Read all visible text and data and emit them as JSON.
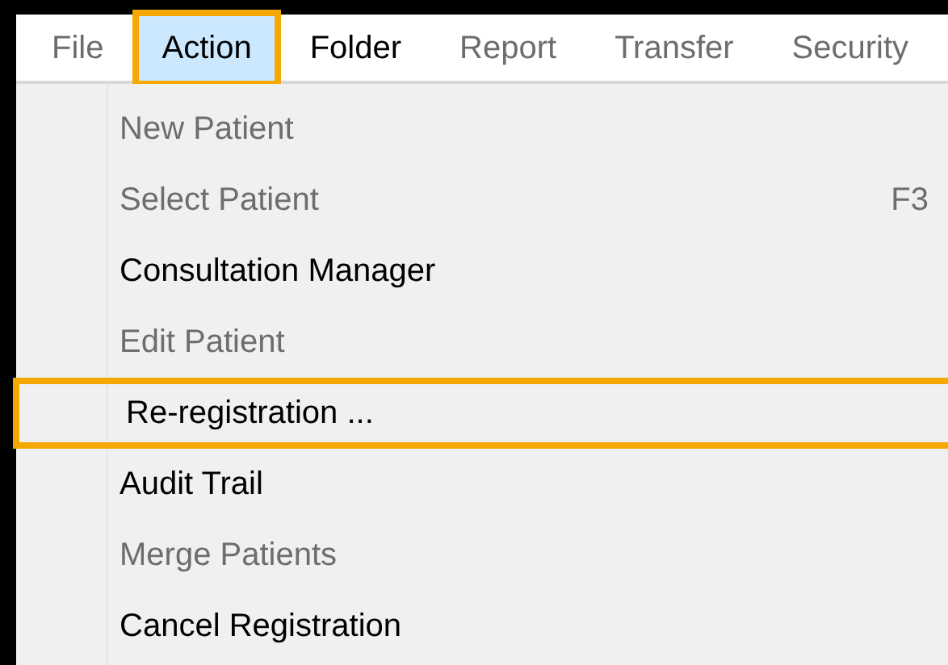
{
  "menu_bar": [
    {
      "label": "File",
      "disabled": true,
      "selected": false,
      "highlighted": false
    },
    {
      "label": "Action",
      "disabled": false,
      "selected": true,
      "highlighted": true
    },
    {
      "label": "Folder",
      "disabled": false,
      "selected": false,
      "highlighted": false
    },
    {
      "label": "Report",
      "disabled": true,
      "selected": false,
      "highlighted": false
    },
    {
      "label": "Transfer",
      "disabled": true,
      "selected": false,
      "highlighted": false
    },
    {
      "label": "Security",
      "disabled": true,
      "selected": false,
      "highlighted": false
    }
  ],
  "menu_items": [
    {
      "label": "New Patient",
      "disabled": true,
      "highlighted": false
    },
    {
      "label": "Select Patient",
      "shortcut": "F3",
      "disabled": true,
      "highlighted": false
    },
    {
      "label": "Consultation Manager",
      "disabled": false,
      "highlighted": false
    },
    {
      "label": "Edit Patient",
      "disabled": true,
      "highlighted": false
    },
    {
      "label": "Re-registration ...",
      "disabled": false,
      "highlighted": true
    },
    {
      "label": "Audit Trail",
      "disabled": false,
      "highlighted": false
    },
    {
      "label": "Merge Patients",
      "disabled": true,
      "highlighted": false
    },
    {
      "label": "Cancel Registration",
      "disabled": false,
      "highlighted": false
    }
  ]
}
